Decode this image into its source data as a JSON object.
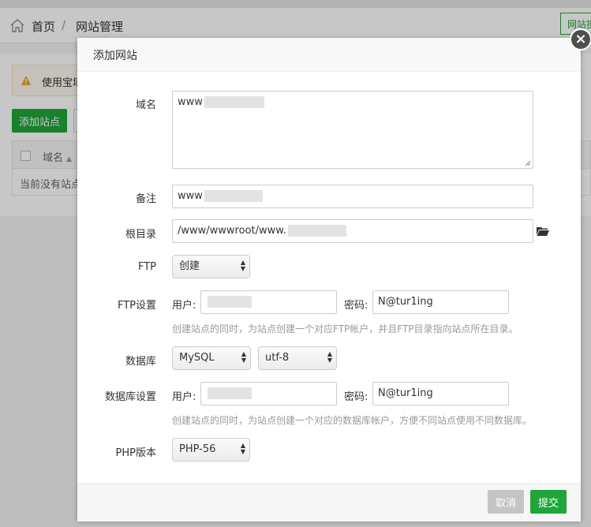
{
  "background": {
    "breadcrumb": {
      "home": "首页",
      "separator": "/",
      "current": "网站管理"
    },
    "top_right_button": "网站掛",
    "warning_text": "使用宝塔",
    "add_site_button": "添加站点",
    "table": {
      "column_name": "域名",
      "empty_text": "当前没有站点"
    }
  },
  "modal": {
    "title": "添加网站",
    "close_label": "×",
    "fields": {
      "domain": {
        "label": "域名",
        "value": "www"
      },
      "remark": {
        "label": "备注",
        "value": "www"
      },
      "root_dir": {
        "label": "根目录",
        "value": "/www/wwwroot/www."
      },
      "ftp": {
        "label": "FTP",
        "selected": "创建"
      },
      "ftp_settings": {
        "label": "FTP设置",
        "user_label": "用户:",
        "password_label": "密码:",
        "password_value": "N@tur1ing",
        "hint": "创建站点的同时，为站点创建一个对应FTP帐户，并且FTP目录指向站点所在目录。"
      },
      "database": {
        "label": "数据库",
        "selected": "MySQL",
        "charset": "utf-8"
      },
      "db_settings": {
        "label": "数据库设置",
        "user_label": "用户:",
        "password_label": "密码:",
        "password_value": "N@tur1ing",
        "hint": "创建站点的同时，为站点创建一个对应的数据库帐户，方便不同站点使用不同数据库。"
      },
      "php_version": {
        "label": "PHP版本",
        "selected": "PHP-56"
      }
    },
    "footer": {
      "cancel": "取消",
      "submit": "提交"
    }
  },
  "colors": {
    "accent": "#20a53a",
    "cancel": "#c4c4c4",
    "warning": "#f0a020"
  },
  "icons": [
    "home-icon",
    "warning-icon",
    "close-icon",
    "folder-icon",
    "sort-up-icon",
    "select-arrows-icon"
  ]
}
